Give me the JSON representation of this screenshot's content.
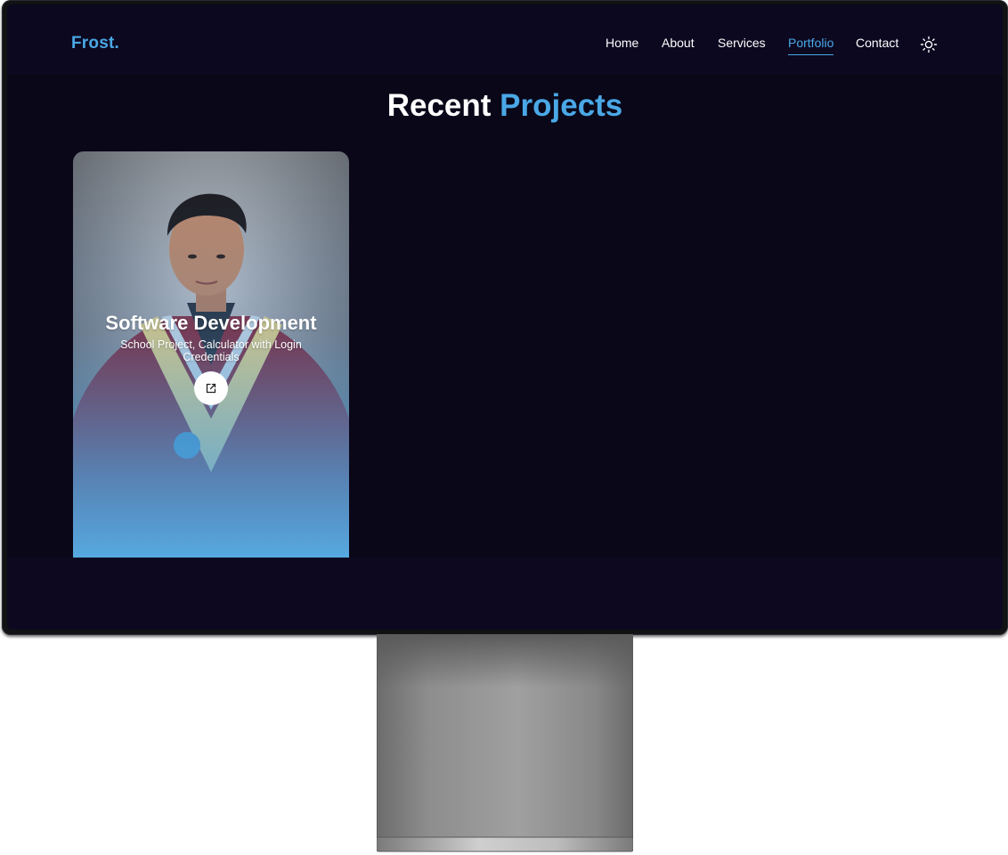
{
  "brand": {
    "logo": "Frost."
  },
  "nav": {
    "items": [
      {
        "label": "Home",
        "active": false
      },
      {
        "label": "About",
        "active": false
      },
      {
        "label": "Services",
        "active": false
      },
      {
        "label": "Portfolio",
        "active": true
      },
      {
        "label": "Contact",
        "active": false
      }
    ],
    "theme_toggle_icon": "sun-icon"
  },
  "portfolio": {
    "heading_primary": "Recent",
    "heading_accent": "Projects",
    "projects": [
      {
        "title": "Software Development",
        "description": "School Project, Calculator with Login Credentials",
        "link_icon": "external-link-icon"
      }
    ]
  },
  "colors": {
    "accent": "#4aa8e6",
    "background": "#0a0719",
    "header_background": "#0c0820",
    "text": "#ffffff"
  }
}
